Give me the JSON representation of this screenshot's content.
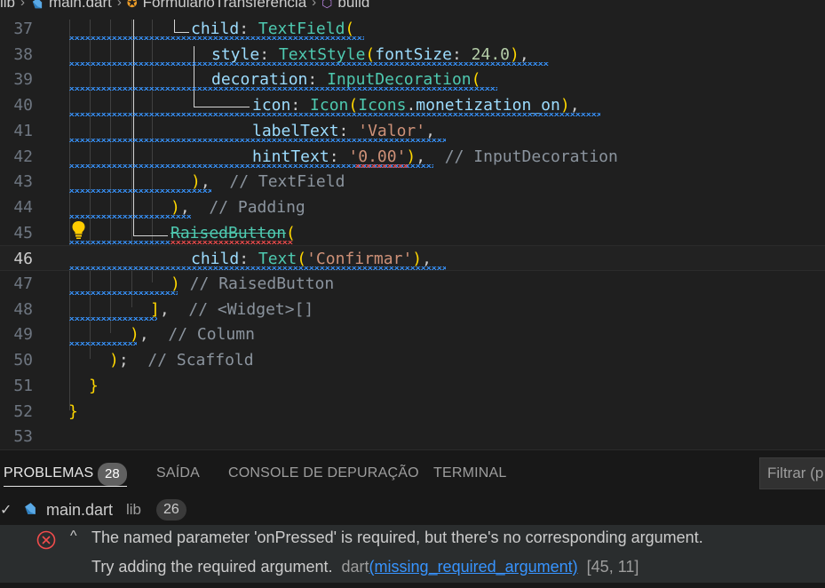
{
  "breadcrumb": {
    "items": [
      "lib",
      "main.dart",
      "FormularioTransferencia",
      "build"
    ],
    "icons": [
      "",
      "dart-icon",
      "class-icon",
      "method-icon"
    ]
  },
  "editor": {
    "current_line": 46,
    "lines": [
      {
        "n": "37",
        "tokens": [
          [
            "prop",
            "child"
          ],
          [
            "punc",
            ": "
          ],
          [
            "cls",
            "TextField"
          ],
          [
            "brkt",
            "("
          ]
        ]
      },
      {
        "n": "38",
        "tokens": [
          [
            "prop",
            "style"
          ],
          [
            "punc",
            ": "
          ],
          [
            "cls",
            "TextStyle"
          ],
          [
            "brkt",
            "("
          ],
          [
            "prop",
            "fontSize"
          ],
          [
            "punc",
            ": "
          ],
          [
            "num",
            "24.0"
          ],
          [
            "brkt",
            ")"
          ],
          [
            "punc",
            ","
          ]
        ]
      },
      {
        "n": "39",
        "tokens": [
          [
            "prop",
            "decoration"
          ],
          [
            "punc",
            ": "
          ],
          [
            "cls",
            "InputDecoration"
          ],
          [
            "brkt",
            "("
          ]
        ]
      },
      {
        "n": "40",
        "tokens": [
          [
            "prop",
            "icon"
          ],
          [
            "punc",
            ": "
          ],
          [
            "cls",
            "Icon"
          ],
          [
            "brkt",
            "("
          ],
          [
            "cls",
            "Icons"
          ],
          [
            "punc",
            "."
          ],
          [
            "prop",
            "monetization_on"
          ],
          [
            "brkt",
            ")"
          ],
          [
            "punc",
            ","
          ]
        ]
      },
      {
        "n": "41",
        "tokens": [
          [
            "prop",
            "labelText"
          ],
          [
            "punc",
            ": "
          ],
          [
            "str",
            "'Valor'"
          ],
          [
            "punc",
            ","
          ]
        ]
      },
      {
        "n": "42",
        "tokens": [
          [
            "prop",
            "hintText"
          ],
          [
            "punc",
            ": "
          ],
          [
            "str",
            "'0.00'"
          ],
          [
            "brkt",
            ")"
          ],
          [
            "punc",
            ", "
          ],
          [
            "cmt",
            " // InputDecoration"
          ]
        ]
      },
      {
        "n": "43",
        "tokens": [
          [
            "brkt",
            ")"
          ],
          [
            "punc",
            ", "
          ],
          [
            "cmt",
            " // TextField"
          ]
        ]
      },
      {
        "n": "44",
        "tokens": [
          [
            "brkt",
            ")"
          ],
          [
            "punc",
            ", "
          ],
          [
            "cmt",
            " // Padding"
          ]
        ]
      },
      {
        "n": "45",
        "tokens": [
          [
            "depr",
            "RaisedButton"
          ],
          [
            "brkt",
            "("
          ]
        ]
      },
      {
        "n": "46",
        "tokens": [
          [
            "prop",
            "child"
          ],
          [
            "punc",
            ": "
          ],
          [
            "cls",
            "Text"
          ],
          [
            "brkt",
            "("
          ],
          [
            "str",
            "'Confirmar'"
          ],
          [
            "brkt",
            ")"
          ],
          [
            "punc",
            ","
          ]
        ]
      },
      {
        "n": "47",
        "tokens": [
          [
            "brkt",
            ")"
          ],
          [
            "cmt",
            " // RaisedButton"
          ]
        ]
      },
      {
        "n": "48",
        "tokens": [
          [
            "brkt",
            "]"
          ],
          [
            "punc",
            ", "
          ],
          [
            "cmt",
            " // <Widget>[]"
          ]
        ]
      },
      {
        "n": "49",
        "tokens": [
          [
            "brkt",
            ")"
          ],
          [
            "punc",
            ", "
          ],
          [
            "cmt",
            " // Column"
          ]
        ]
      },
      {
        "n": "50",
        "tokens": [
          [
            "brkt",
            ")"
          ],
          [
            "punc",
            "; "
          ],
          [
            "cmt",
            " // Scaffold"
          ]
        ]
      },
      {
        "n": "51",
        "tokens": [
          [
            "brkt",
            "}"
          ]
        ]
      },
      {
        "n": "52",
        "tokens": [
          [
            "brkt",
            "}"
          ]
        ]
      },
      {
        "n": "53",
        "tokens": []
      }
    ]
  },
  "panel": {
    "tabs": [
      {
        "label": "PROBLEMAS",
        "badge": "28",
        "active": true
      },
      {
        "label": "SAÍDA"
      },
      {
        "label": "CONSOLE DE DEPURAÇÃO"
      },
      {
        "label": "TERMINAL"
      }
    ],
    "filter_placeholder": "Filtrar (p",
    "file": {
      "name": "main.dart",
      "dir": "lib",
      "count": "26"
    },
    "error": {
      "message": "The named parameter 'onPressed' is required, but there's no corresponding argument.",
      "hint": "Try adding the required argument.",
      "source": "dart",
      "code": "(missing_required_argument)",
      "position": "[45, 11]"
    }
  },
  "colors": {
    "property": "#9cdcfe",
    "class": "#4ec9b0",
    "string": "#ce9178",
    "number": "#b5cea8",
    "error": "#f14c4c",
    "info_squiggle": "#3794ff",
    "lightbulb": "#ffcc00"
  }
}
